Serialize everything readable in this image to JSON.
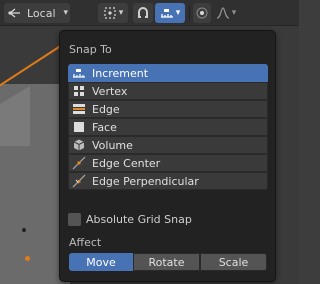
{
  "header": {
    "orientation_label": "Local",
    "colors": {
      "accent": "#4772b3",
      "bar": "#303030"
    }
  },
  "popup": {
    "title": "Snap To",
    "items": [
      {
        "label": "Increment",
        "icon": "increment-icon",
        "active": true
      },
      {
        "label": "Vertex",
        "icon": "vertex-icon",
        "active": false
      },
      {
        "label": "Edge",
        "icon": "edge-icon",
        "active": false
      },
      {
        "label": "Face",
        "icon": "face-icon",
        "active": false
      },
      {
        "label": "Volume",
        "icon": "volume-icon",
        "active": false
      },
      {
        "label": "Edge Center",
        "icon": "edge-center-icon",
        "active": false
      },
      {
        "label": "Edge Perpendicular",
        "icon": "edge-perpendicular-icon",
        "active": false
      }
    ],
    "absolute_grid_snap_label": "Absolute Grid Snap",
    "absolute_grid_snap_checked": false,
    "affect_label": "Affect",
    "affect_options": [
      {
        "label": "Move",
        "active": true
      },
      {
        "label": "Rotate",
        "active": false
      },
      {
        "label": "Scale",
        "active": false
      }
    ]
  }
}
